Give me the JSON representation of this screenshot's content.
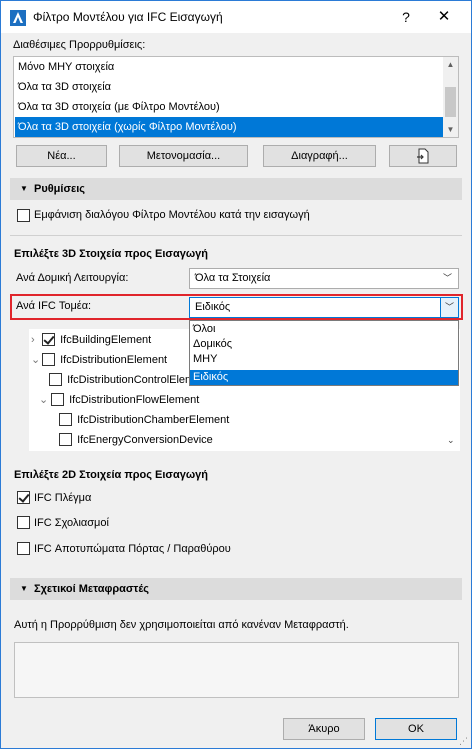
{
  "window": {
    "title": "Φίλτρο Μοντέλου για IFC Εισαγωγή",
    "help_label": "?",
    "close_label": "✕",
    "accent_color": "#0078d7",
    "highlight_color": "#e0252b"
  },
  "presets": {
    "label": "Διαθέσιμες Προρρυθμίσεις:",
    "items": [
      "Μόνο ΜΗΥ στοιχεία",
      "Όλα τα 3D στοιχεία",
      "Όλα τα 3D στοιχεία (με Φίλτρο Μοντέλου)",
      "Όλα τα 3D στοιχεία (χωρίς Φίλτρο Μοντέλου)"
    ],
    "selected_index": 3,
    "buttons": {
      "new": "Νέα...",
      "rename": "Μετονομασία...",
      "delete": "Διαγραφή...",
      "import_icon": "import-icon"
    }
  },
  "settings": {
    "header": "Ρυθμίσεις",
    "show_dialog_label": "Εμφάνιση διαλόγου Φίλτρο Μοντέλου κατά την εισαγωγή",
    "show_dialog_checked": false
  },
  "select3d": {
    "heading": "Επιλέξτε 3D Στοιχεία προς Εισαγωγή",
    "structural_label": "Ανά Δομική Λειτουργία:",
    "structural_value": "Όλα τα Στοιχεία",
    "domain_label": "Ανά IFC Τομέα:",
    "domain_value": "Ειδικός",
    "domain_options": [
      "Όλοι",
      "Δομικός",
      "ΜΗΥ",
      "Ειδικός"
    ],
    "domain_selected_index": 3,
    "tree": [
      {
        "label": "IfcBuildingElement",
        "checked": true,
        "expander": "›"
      },
      {
        "label": "IfcDistributionElement",
        "checked": false,
        "expander": "⌄"
      },
      {
        "label": "IfcDistributionControlElement",
        "checked": false,
        "expander": ""
      },
      {
        "label": "IfcDistributionFlowElement",
        "checked": false,
        "expander": "⌄"
      },
      {
        "label": "IfcDistributionChamberElement",
        "checked": false,
        "expander": ""
      },
      {
        "label": "IfcEnergyConversionDevice",
        "checked": false,
        "expander": ""
      }
    ]
  },
  "select2d": {
    "heading": "Επιλέξτε 2D Στοιχεία προς Εισαγωγή",
    "items": [
      {
        "label": "IFC Πλέγμα",
        "checked": true
      },
      {
        "label": "IFC Σχολιασμοί",
        "checked": false
      },
      {
        "label": "IFC Αποτυπώματα Πόρτας / Παραθύρου",
        "checked": false
      }
    ]
  },
  "translators": {
    "header": "Σχετικοί Μεταφραστές",
    "note": "Αυτή η Προρρύθμιση δεν χρησιμοποιείται από κανέναν Μεταφραστή."
  },
  "footer": {
    "cancel": "Άκυρο",
    "ok": "OK"
  }
}
